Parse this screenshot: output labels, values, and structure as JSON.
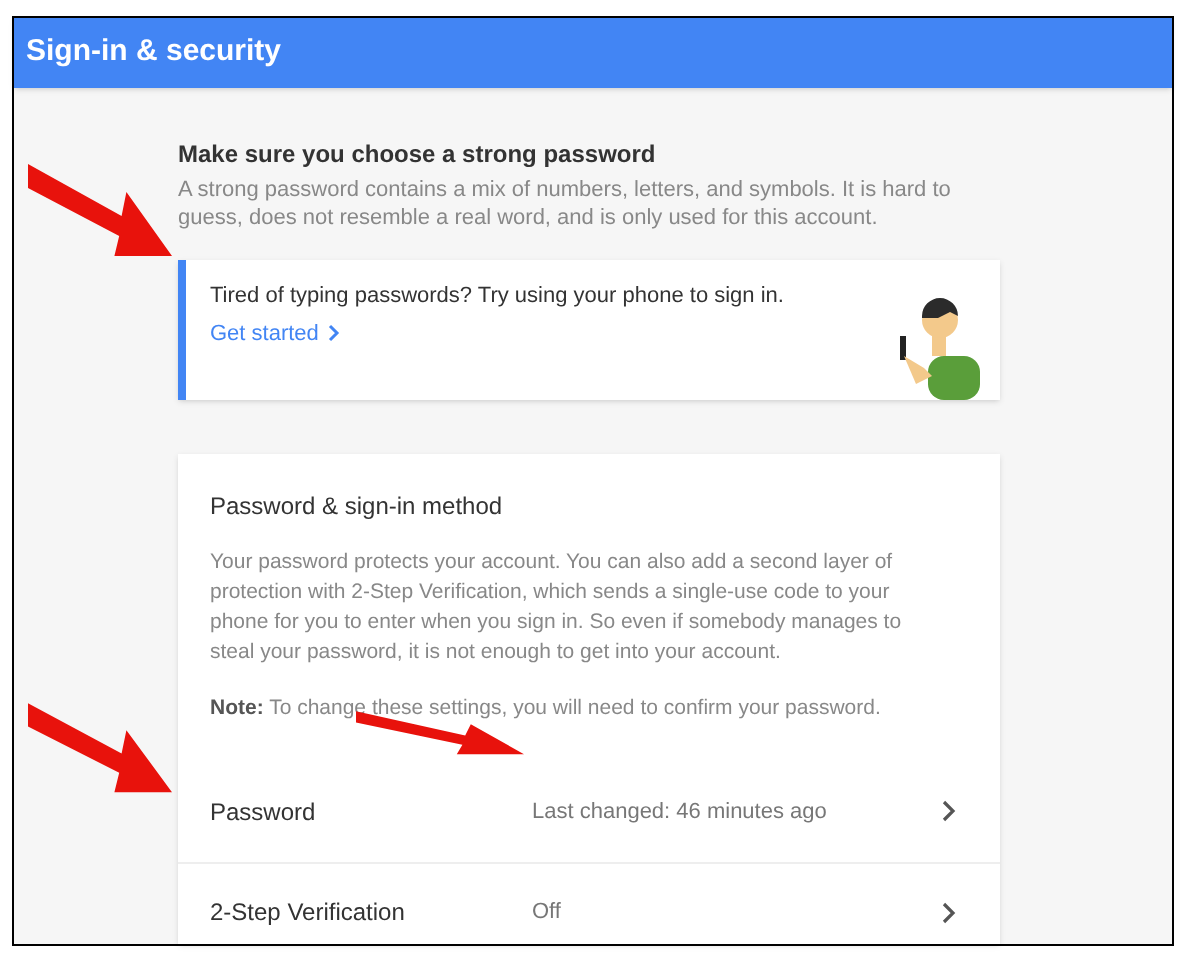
{
  "header": {
    "title": "Sign-in & security"
  },
  "password_tips": {
    "heading": "Make sure you choose a strong password",
    "text": "A strong password contains a mix of numbers, letters, and symbols. It is hard to guess, does not resemble a real word, and is only used for this account."
  },
  "promo": {
    "text": "Tired of typing passwords? Try using your phone to sign in.",
    "link": "Get started"
  },
  "method_card": {
    "title": "Password & sign-in method",
    "description": "Your password protects your account. You can also add a second layer of protection with 2-Step Verification, which sends a single-use code to your phone for you to enter when you sign in. So even if somebody manages to steal your password, it is not enough to get into your account.",
    "note": "**Note:** To change these settings, you will need to confirm your password.",
    "rows": [
      {
        "label": "Password",
        "value": "Last changed: 46 minutes ago"
      },
      {
        "label": "2-Step Verification",
        "value": "Off"
      }
    ]
  }
}
